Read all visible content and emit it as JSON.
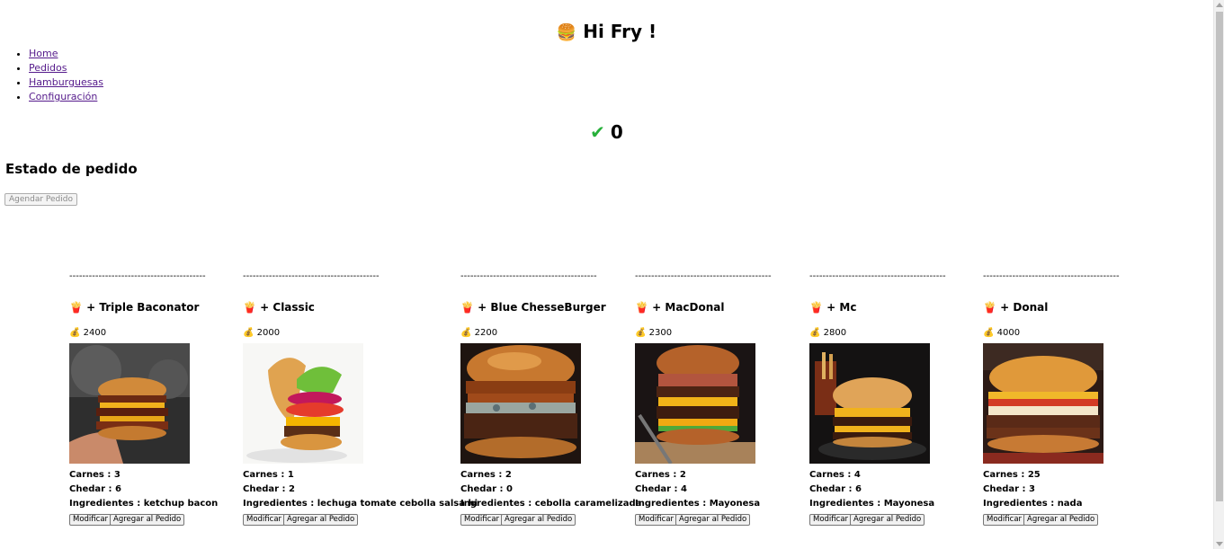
{
  "header": {
    "title_emoji": "🍔",
    "title": "Hi Fry !"
  },
  "nav": [
    {
      "label": "Home"
    },
    {
      "label": "Pedidos"
    },
    {
      "label": "Hamburguesas"
    },
    {
      "label": "Configuración"
    }
  ],
  "counter": {
    "icon": "check-mark",
    "value": "0"
  },
  "estado": {
    "heading": "Estado de pedido",
    "button_label": "Agendar Pedido"
  },
  "card_labels": {
    "separator": "------------------------------------------",
    "fries_emoji": "🍟",
    "plus": "+",
    "money_emoji": "💰",
    "carnes": "Carnes :",
    "chedar": "Chedar :",
    "ingredientes": "Ingredientes :",
    "modify": "Modificar",
    "add": "Agregar al Pedido"
  },
  "burgers": [
    {
      "name": "Triple Baconator",
      "price": "2400",
      "carnes": "3",
      "chedar": "6",
      "ingredientes": "ketchup bacon"
    },
    {
      "name": "Classic",
      "price": "2000",
      "carnes": "1",
      "chedar": "2",
      "ingredientes": "lechuga tomate cebolla salsa hi"
    },
    {
      "name": "Blue ChesseBurger",
      "price": "2200",
      "carnes": "2",
      "chedar": "0",
      "ingredientes": "cebolla caramelizada"
    },
    {
      "name": "MacDonal",
      "price": "2300",
      "carnes": "2",
      "chedar": "4",
      "ingredientes": "Mayonesa"
    },
    {
      "name": "Mc",
      "price": "2800",
      "carnes": "4",
      "chedar": "6",
      "ingredientes": "Mayonesa"
    },
    {
      "name": "Donal",
      "price": "4000",
      "carnes": "25",
      "chedar": "3",
      "ingredientes": "nada"
    }
  ],
  "colors": {
    "link": "#551a8b",
    "check": "#27b03a"
  }
}
